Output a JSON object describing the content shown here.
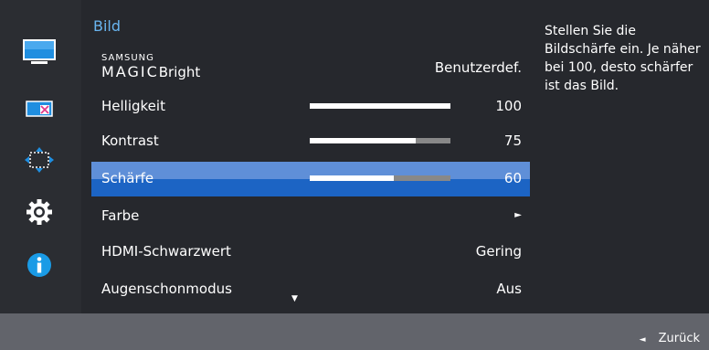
{
  "menu": {
    "title": "Bild",
    "magic_bright": {
      "brand_top": "SAMSUNG",
      "brand_main": "MAGIC",
      "label": "Bright",
      "value": "Benutzerdef."
    },
    "items": [
      {
        "label": "Helligkeit",
        "value": "100",
        "bar_fraction": 1.0
      },
      {
        "label": "Kontrast",
        "value": "75",
        "bar_fraction": 0.75
      },
      {
        "label": "Schärfe",
        "value": "60",
        "bar_fraction": 0.6,
        "selected": true
      },
      {
        "label": "Farbe",
        "value": "►"
      },
      {
        "label": "HDMI-Schwarzwert",
        "value": "Gering"
      },
      {
        "label": "Augenschonmodus",
        "value": "Aus"
      }
    ],
    "scroll_indicator": "▼"
  },
  "help_text": "Stellen Sie die Bildschärfe ein. Je näher bei 100, desto schärfer ist das Bild.",
  "footer": {
    "back_icon": "◄",
    "back_label": "Zurück"
  },
  "sidebar_icons": [
    "picture-icon",
    "screen-adjust-icon",
    "position-icon",
    "settings-gear-icon",
    "info-icon"
  ],
  "colors": {
    "accent": "#69b5f0",
    "selected_top": "#5f8fd8",
    "selected_bottom": "#1c64c4",
    "info": "#1a9be6"
  }
}
